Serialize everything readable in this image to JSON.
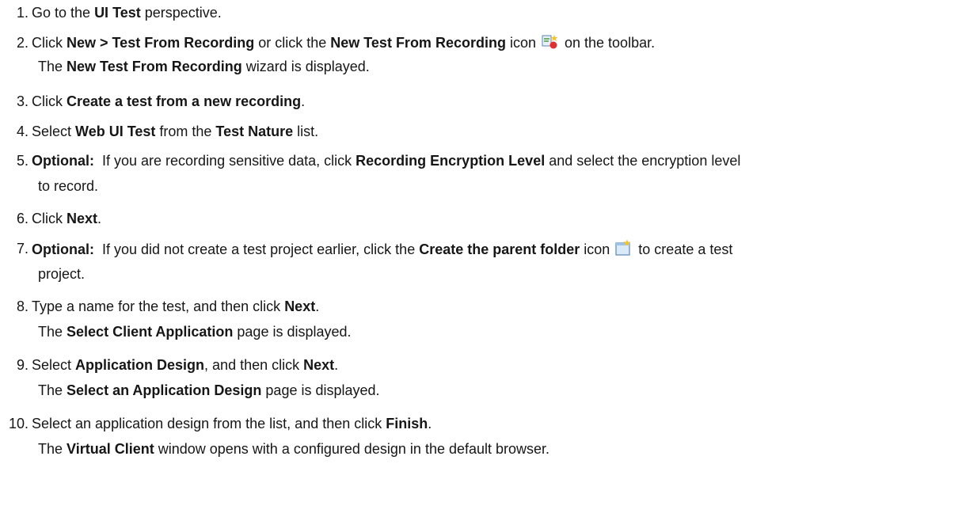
{
  "steps": [
    {
      "num": "1.",
      "pre": "Go to the ",
      "b1": "UI Test",
      "post": " perspective."
    },
    {
      "num": "2.",
      "pre": "Click ",
      "b1": "New > Test From Recording",
      "mid": " or click the ",
      "b2": "New Test From Recording",
      "mid2": " icon",
      "post": " on the toolbar.",
      "sub_pre": "The ",
      "sub_b": "New Test From Recording",
      "sub_post": " wizard is displayed."
    },
    {
      "num": "3.",
      "pre": "Click ",
      "b1": "Create a test from a new recording",
      "post": "."
    },
    {
      "num": "4.",
      "pre": "Select ",
      "b1": "Web UI Test",
      "mid": " from the ",
      "b2": "Test Nature",
      "post": " list."
    },
    {
      "num": "5.",
      "b0": "Optional:",
      "pre": "  If you are recording sensitive data, click ",
      "b1": "Recording Encryption Level",
      "post": " and select the encryption level",
      "wrap": "to record."
    },
    {
      "num": "6.",
      "pre": "Click ",
      "b1": "Next",
      "post": "."
    },
    {
      "num": "7.",
      "b0": "Optional:",
      "pre": "  If you did not create a test project earlier, click the ",
      "b1": "Create the parent folder",
      "mid2": " icon",
      "post": " to create a test",
      "wrap": "project."
    },
    {
      "num": "8.",
      "pre": "Type a name for the test, and then click ",
      "b1": "Next",
      "post": ".",
      "sub_pre": "The ",
      "sub_b": "Select Client Application",
      "sub_post": " page is displayed."
    },
    {
      "num": "9.",
      "pre": "Select ",
      "b1": "Application Design",
      "mid": ", and then click ",
      "b2": "Next",
      "post": ".",
      "sub_pre": "The ",
      "sub_b": "Select an Application Design",
      "sub_post": " page is displayed."
    },
    {
      "num": "10.",
      "pre": "Select an application design from the list, and then click ",
      "b1": "Finish",
      "post": ".",
      "sub_pre": "The ",
      "sub_b": "Virtual Client",
      "sub_post": " window opens with a configured design in the default browser."
    }
  ]
}
